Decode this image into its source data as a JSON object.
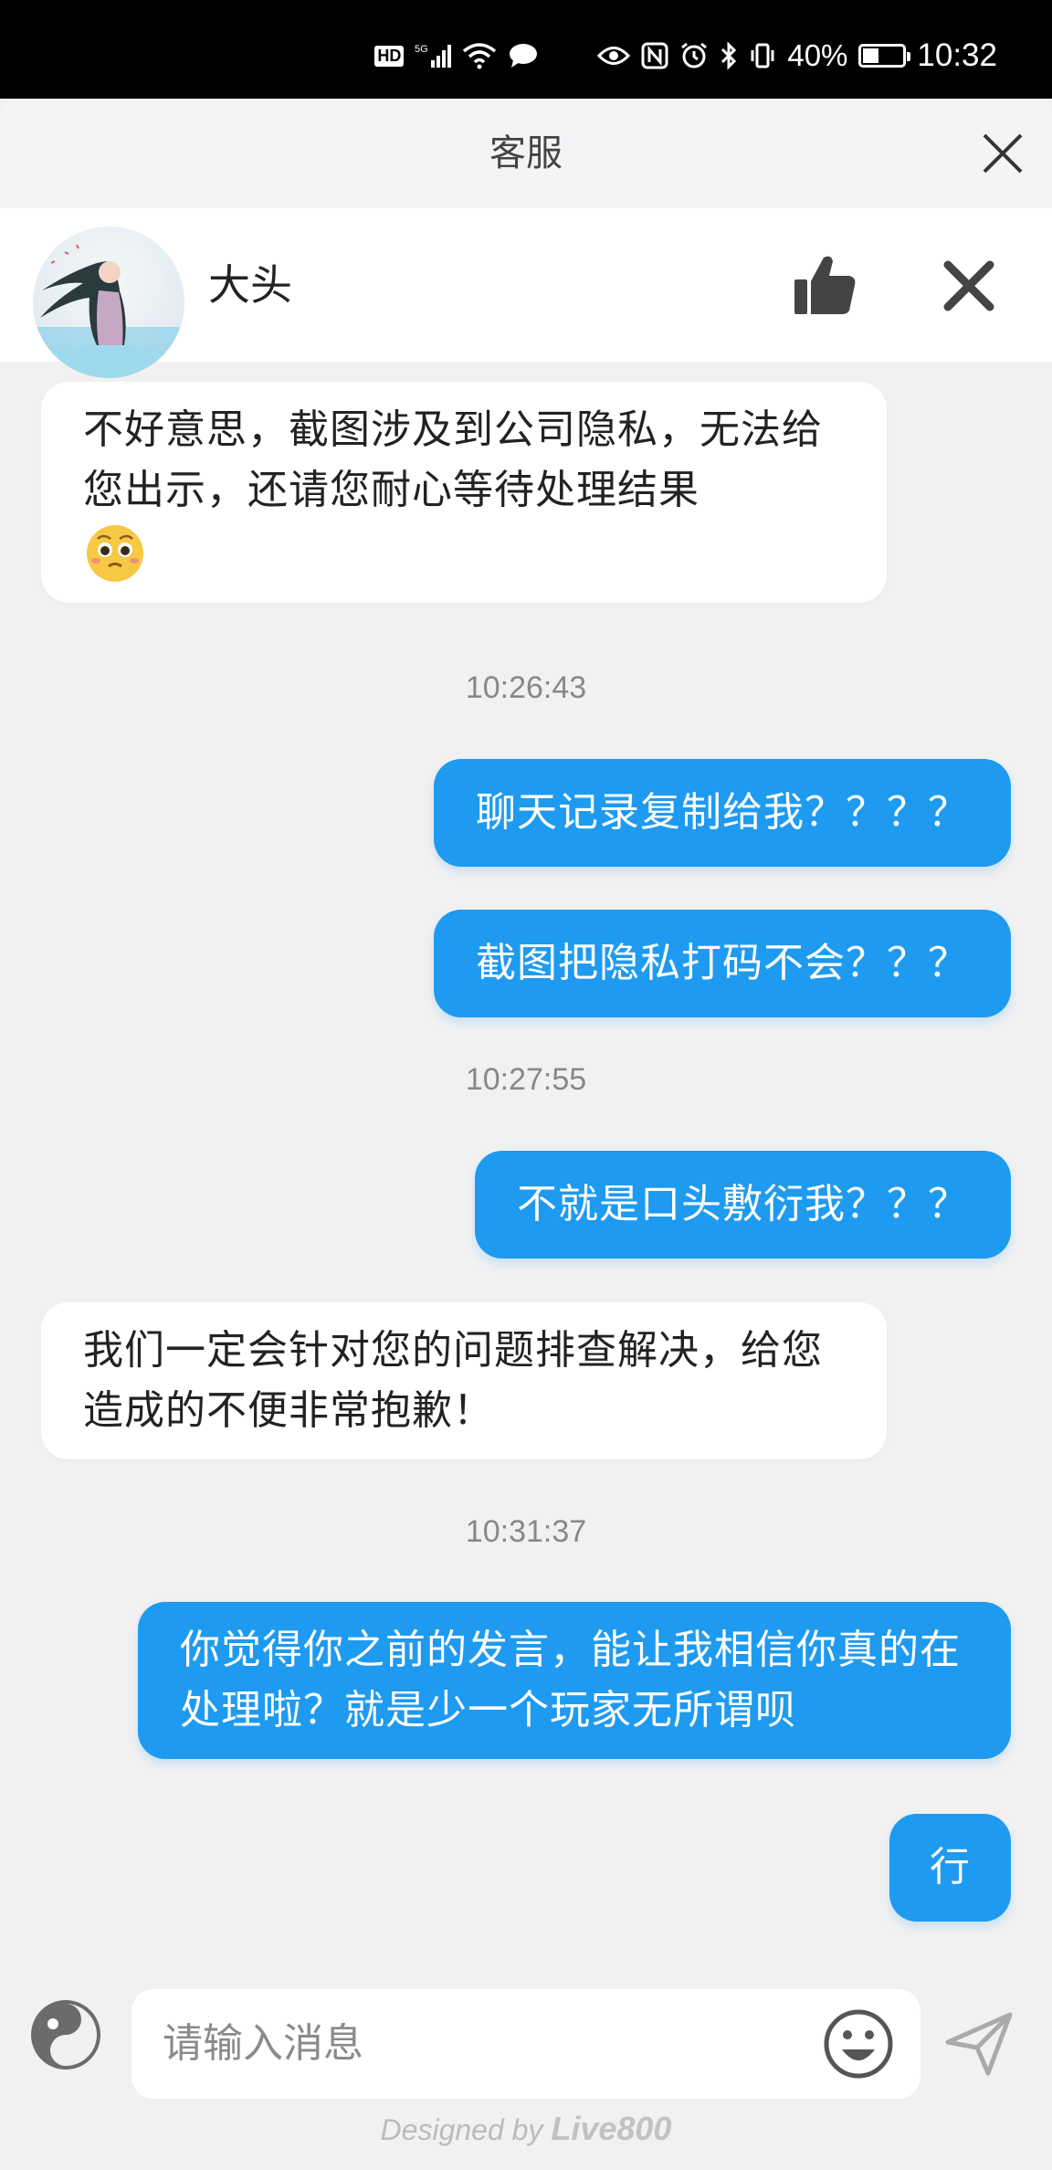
{
  "status_bar": {
    "network": "5G",
    "battery_percent": "40%",
    "battery_level": 0.4,
    "time": "10:32"
  },
  "header": {
    "title": "客服"
  },
  "agent": {
    "name": "大头"
  },
  "messages": [
    {
      "type": "in",
      "text": "不好意思，截图涉及到公司隐私，无法给您出示，还请您耐心等待处理结果",
      "emoji": "pleading-face"
    },
    {
      "type": "time",
      "text": "10:26:43"
    },
    {
      "type": "out",
      "text": "聊天记录复制给我？？？？"
    },
    {
      "type": "out",
      "text": "截图把隐私打码不会？？？"
    },
    {
      "type": "time",
      "text": "10:27:55"
    },
    {
      "type": "out",
      "text": "不就是口头敷衍我？？？"
    },
    {
      "type": "in",
      "text": "我们一定会针对您的问题排查解决，给您造成的不便非常抱歉！"
    },
    {
      "type": "time",
      "text": "10:31:37"
    },
    {
      "type": "out",
      "text": "你觉得你之前的发言，能让我相信你真的在处理啦？就是少一个玩家无所谓呗"
    },
    {
      "type": "out",
      "text": "行"
    }
  ],
  "composer": {
    "placeholder": "请输入消息"
  },
  "footer": {
    "prefix": "Designed by",
    "brand": "Live800"
  },
  "colors": {
    "outgoing_bubble": "#1e9af0",
    "incoming_bubble": "#ffffff",
    "background": "#f1f1f2"
  }
}
